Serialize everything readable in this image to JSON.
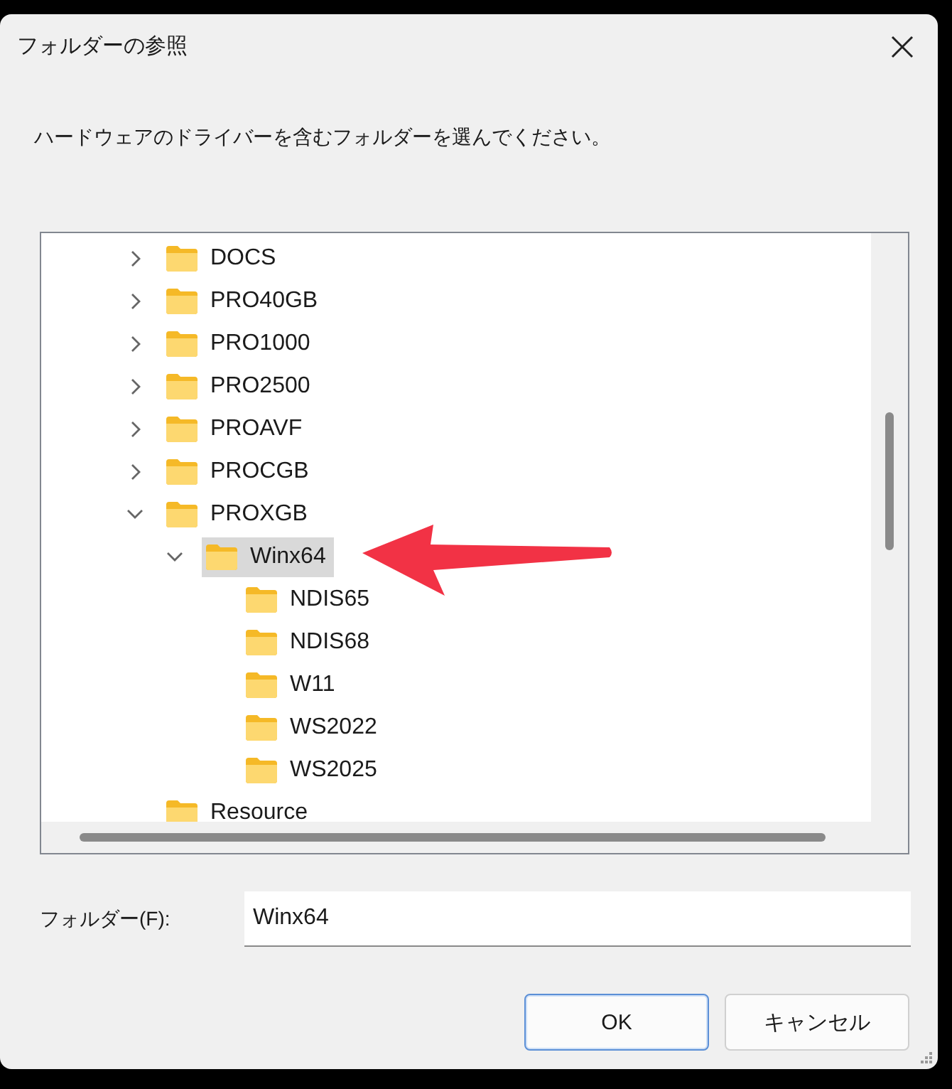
{
  "window": {
    "title": "フォルダーの参照"
  },
  "instruction": "ハードウェアのドライバーを含むフォルダーを選んでください。",
  "tree": [
    {
      "label": "DOCS",
      "kind": "branch",
      "expanded": false,
      "selected": false
    },
    {
      "label": "PRO40GB",
      "kind": "branch",
      "expanded": false,
      "selected": false
    },
    {
      "label": "PRO1000",
      "kind": "branch",
      "expanded": false,
      "selected": false
    },
    {
      "label": "PRO2500",
      "kind": "branch",
      "expanded": false,
      "selected": false
    },
    {
      "label": "PROAVF",
      "kind": "branch",
      "expanded": false,
      "selected": false
    },
    {
      "label": "PROCGB",
      "kind": "branch",
      "expanded": false,
      "selected": false
    },
    {
      "label": "PROXGB",
      "kind": "branch",
      "expanded": true,
      "selected": false,
      "children": [
        {
          "label": "Winx64",
          "kind": "branch",
          "expanded": true,
          "selected": true,
          "children": [
            {
              "label": "NDIS65",
              "kind": "leaf",
              "selected": false
            },
            {
              "label": "NDIS68",
              "kind": "leaf",
              "selected": false
            },
            {
              "label": "W11",
              "kind": "leaf",
              "selected": false
            },
            {
              "label": "WS2022",
              "kind": "leaf",
              "selected": false
            },
            {
              "label": "WS2025",
              "kind": "leaf",
              "selected": false
            }
          ]
        }
      ]
    },
    {
      "label": "Resource",
      "kind": "leaf",
      "selected": false
    }
  ],
  "folder_field": {
    "label": "フォルダー(F):",
    "value": "Winx64"
  },
  "buttons": [
    {
      "label": "OK",
      "default": true
    },
    {
      "label": "キャンセル",
      "default": false
    }
  ]
}
